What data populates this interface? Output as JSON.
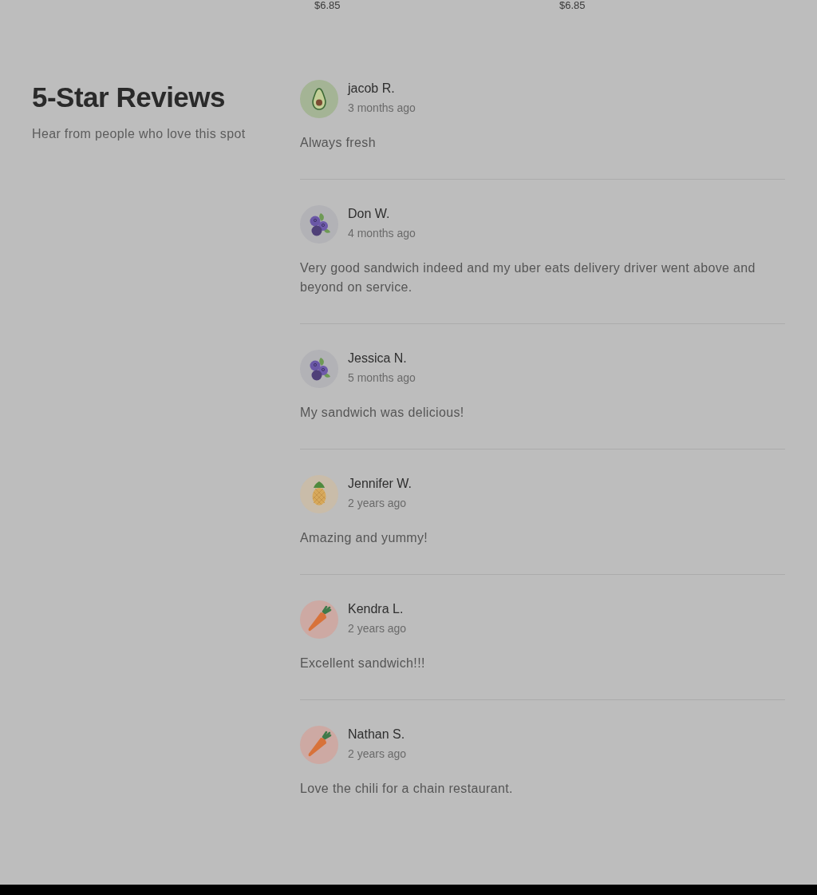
{
  "menu_items": [
    {
      "price": "$6.85"
    },
    {
      "price": "$6.85"
    }
  ],
  "reviews_section": {
    "title": "5-Star Reviews",
    "subtitle": "Hear from people who love this spot",
    "reviews": [
      {
        "kind": "avocado",
        "name": "jacob R.",
        "time": "3 months ago",
        "text": "Always fresh"
      },
      {
        "kind": "blueberry",
        "name": "Don W.",
        "time": "4 months ago",
        "text": "Very good sandwich indeed and my uber eats delivery driver went above and beyond on service."
      },
      {
        "kind": "blueberry",
        "name": "Jessica N.",
        "time": "5 months ago",
        "text": "My sandwich was delicious!"
      },
      {
        "kind": "pineapple",
        "name": "Jennifer W.",
        "time": "2 years ago",
        "text": "Amazing and yummy!"
      },
      {
        "kind": "carrot",
        "name": "Kendra L.",
        "time": "2 years ago",
        "text": "Excellent sandwich!!!"
      },
      {
        "kind": "carrot",
        "name": "Nathan S.",
        "time": "2 years ago",
        "text": "Love the chili for a chain restaurant."
      }
    ]
  }
}
